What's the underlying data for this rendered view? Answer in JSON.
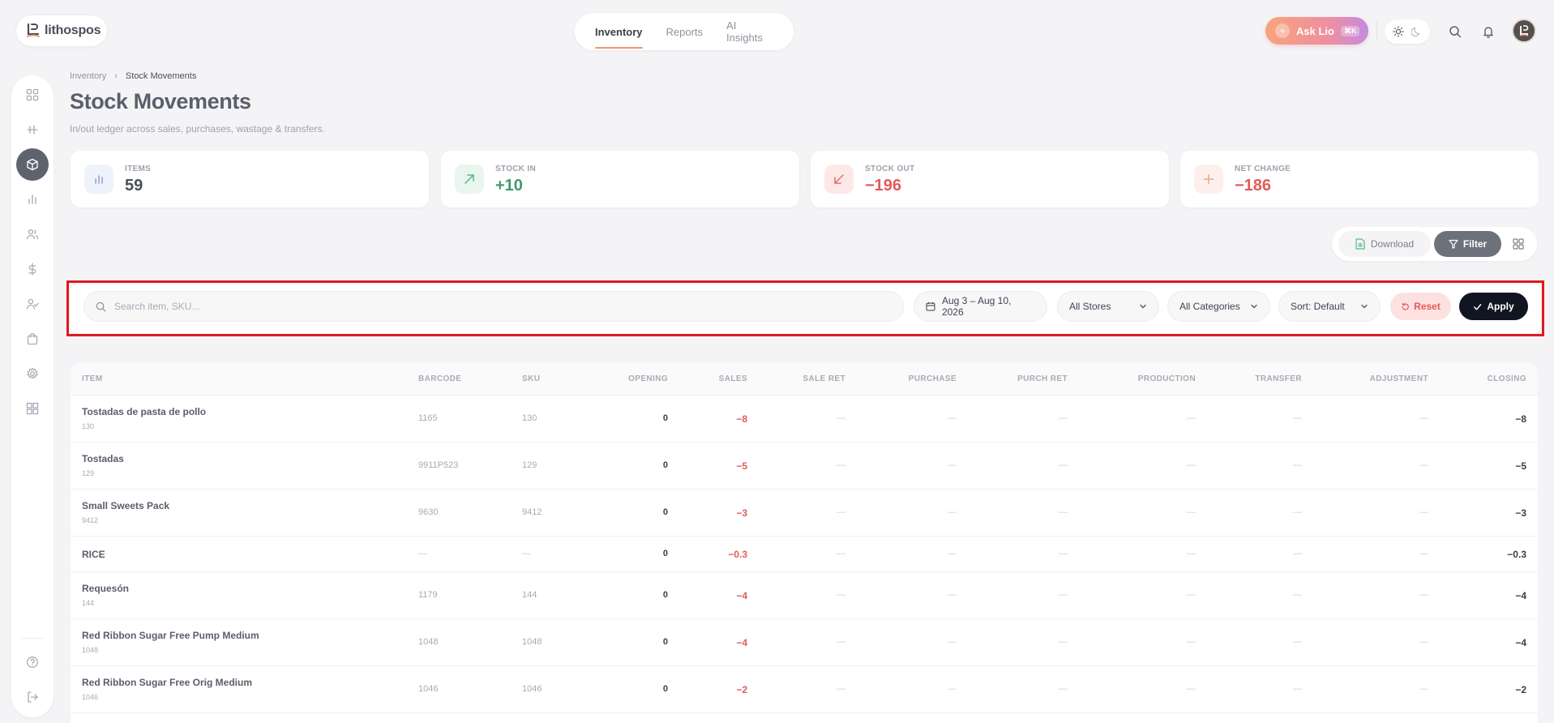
{
  "app": {
    "name": "lithospos"
  },
  "top_nav": {
    "tabs": [
      "Inventory",
      "Reports",
      "AI Insights"
    ],
    "active": "Inventory"
  },
  "ask_lio": {
    "label": "Ask Lio",
    "shortcut": "⌘K"
  },
  "breadcrumb": {
    "parent": "Inventory",
    "separator": "›",
    "current": "Stock Movements"
  },
  "page": {
    "title": "Stock Movements",
    "subtitle": "In/out ledger across sales, purchases, wastage & transfers."
  },
  "stats": [
    {
      "label": "ITEMS",
      "value": "59",
      "icon": "bar-chart-icon",
      "color": "#4a4e5a",
      "icon_bg": "#eef2fa",
      "icon_color": "#8ea3c8"
    },
    {
      "label": "STOCK IN",
      "value": "+10",
      "icon": "arrow-up-right-icon",
      "color": "#3f9a70",
      "icon_bg": "#e9f6ef",
      "icon_color": "#55b88a"
    },
    {
      "label": "STOCK OUT",
      "value": "−196",
      "icon": "arrow-down-left-icon",
      "color": "#e25a5a",
      "icon_bg": "#fde8e8",
      "icon_color": "#e86b6b"
    },
    {
      "label": "NET CHANGE",
      "value": "−186",
      "icon": "plus-icon",
      "color": "#e25a5a",
      "icon_bg": "#fdf0ec",
      "icon_color": "#f0a58e"
    }
  ],
  "actions": {
    "download": "Download",
    "filter": "Filter"
  },
  "filters": {
    "search_placeholder": "Search item, SKU...",
    "search_value": "",
    "date_range": "Aug 3 – Aug 10, 2026",
    "store": "All Stores",
    "category": "All Categories",
    "sort": "Sort: Default",
    "reset": "Reset",
    "apply": "Apply"
  },
  "table": {
    "columns": [
      "ITEM",
      "BARCODE",
      "SKU",
      "OPENING",
      "SALES",
      "SALE RET",
      "PURCHASE",
      "PURCH RET",
      "PRODUCTION",
      "TRANSFER",
      "ADJUSTMENT",
      "CLOSING"
    ],
    "rows": [
      {
        "name": "Tostadas de pasta de pollo",
        "sub": "130",
        "barcode": "1165",
        "sku": "130",
        "opening": "0",
        "sales": "−8",
        "sale_ret": "—",
        "purchase": "—",
        "purch_ret": "—",
        "production": "—",
        "transfer": "—",
        "adjustment": "—",
        "closing": "−8"
      },
      {
        "name": "Tostadas",
        "sub": "129",
        "barcode": "9911P523",
        "sku": "129",
        "opening": "0",
        "sales": "−5",
        "sale_ret": "—",
        "purchase": "—",
        "purch_ret": "—",
        "production": "—",
        "transfer": "—",
        "adjustment": "—",
        "closing": "−5"
      },
      {
        "name": "Small Sweets Pack",
        "sub": "9412",
        "barcode": "9630",
        "sku": "9412",
        "opening": "0",
        "sales": "−3",
        "sale_ret": "—",
        "purchase": "—",
        "purch_ret": "—",
        "production": "—",
        "transfer": "—",
        "adjustment": "—",
        "closing": "−3"
      },
      {
        "name": "RICE",
        "sub": "",
        "barcode": "—",
        "sku": "—",
        "opening": "0",
        "sales": "−0.3",
        "sale_ret": "—",
        "purchase": "—",
        "purch_ret": "—",
        "production": "—",
        "transfer": "—",
        "adjustment": "—",
        "closing": "−0.3"
      },
      {
        "name": "Requesón",
        "sub": "144",
        "barcode": "1179",
        "sku": "144",
        "opening": "0",
        "sales": "−4",
        "sale_ret": "—",
        "purchase": "—",
        "purch_ret": "—",
        "production": "—",
        "transfer": "—",
        "adjustment": "—",
        "closing": "−4"
      },
      {
        "name": "Red Ribbon Sugar Free Pump Medium",
        "sub": "1048",
        "barcode": "1048",
        "sku": "1048",
        "opening": "0",
        "sales": "−4",
        "sale_ret": "—",
        "purchase": "—",
        "purch_ret": "—",
        "production": "—",
        "transfer": "—",
        "adjustment": "—",
        "closing": "−4"
      },
      {
        "name": "Red Ribbon Sugar Free Orig Medium",
        "sub": "1046",
        "barcode": "1046",
        "sku": "1046",
        "opening": "0",
        "sales": "−2",
        "sale_ret": "—",
        "purchase": "—",
        "purch_ret": "—",
        "production": "—",
        "transfer": "—",
        "adjustment": "—",
        "closing": "−2"
      }
    ]
  },
  "sidebar": {
    "items": [
      {
        "icon": "dashboard-grid-icon",
        "active": false
      },
      {
        "icon": "pos-icon",
        "active": false
      },
      {
        "icon": "box-icon",
        "active": true
      },
      {
        "icon": "bar-chart-icon",
        "active": false
      },
      {
        "icon": "users-icon",
        "active": false
      },
      {
        "icon": "dollar-icon",
        "active": false
      },
      {
        "icon": "user-check-icon",
        "active": false
      },
      {
        "icon": "shopping-bag-icon",
        "active": false
      },
      {
        "icon": "gear-icon",
        "active": false
      },
      {
        "icon": "apps-icon",
        "active": false
      }
    ],
    "bottom": [
      {
        "icon": "help-icon"
      },
      {
        "icon": "logout-icon"
      }
    ]
  }
}
